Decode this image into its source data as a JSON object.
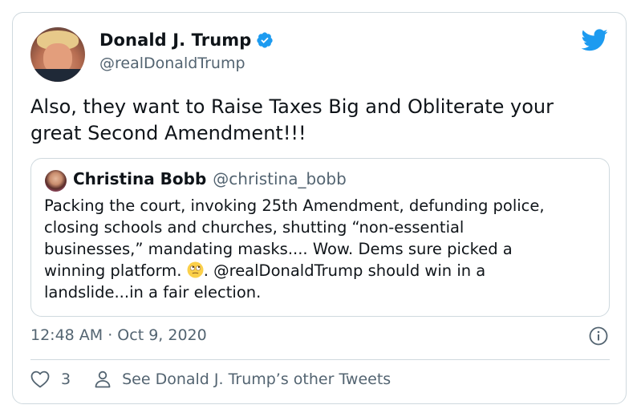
{
  "tweet": {
    "author_name": "Donald J. Trump",
    "author_handle": "@realDonaldTrump",
    "text_line1": "Also, they want to Raise Taxes Big and Obliterate your",
    "text_line2": "great Second Amendment!!!",
    "timestamp": "12:48 AM · Oct 9, 2020"
  },
  "quoted_tweet": {
    "author_name": "Christina Bobb",
    "author_handle": "@christina_bobb",
    "line1": "Packing the court, invoking 25th Amendment, defunding police,",
    "line2": "closing schools and churches, shutting “non-essential",
    "line3": "businesses,” mandating masks....  Wow.  Dems sure picked a",
    "line4_before_emoji": "winning platform. ",
    "line4_after_emoji": ". @realDonaldTrump should win in a",
    "line5": "landslide...in a fair election.",
    "emoji": "face-with-rolling-eyes"
  },
  "actions": {
    "like_count": "3",
    "profile_link_label": "See Donald J. Trump’s other Tweets"
  },
  "colors": {
    "brand_blue": "#1d9bf0",
    "secondary_text": "#536471",
    "border": "#cfd9de"
  }
}
